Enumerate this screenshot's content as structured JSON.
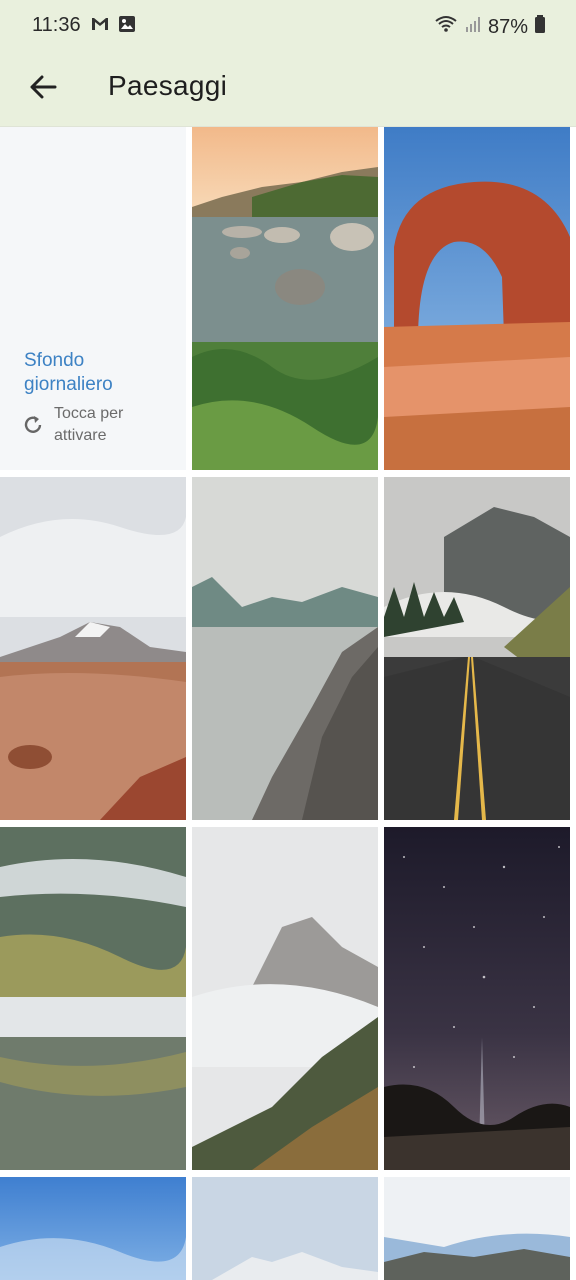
{
  "status_bar": {
    "time": "11:36",
    "notifications": [
      "gmail-icon",
      "image-icon"
    ],
    "battery": "87%"
  },
  "app_bar": {
    "back_icon": "arrow-left-icon",
    "title": "Paesaggi"
  },
  "daily_wallpaper": {
    "label": "Sfondo giornaliero",
    "action_icon": "refresh-icon",
    "action_text": "Tocca per attivare",
    "label_color": "#3d82c4"
  },
  "wallpapers": [
    {
      "id": "lake-rocks"
    },
    {
      "id": "red-arch"
    },
    {
      "id": "desert-volcano"
    },
    {
      "id": "misty-lake-shore"
    },
    {
      "id": "mountain-road"
    },
    {
      "id": "foggy-forest-lake"
    },
    {
      "id": "misty-peaks"
    },
    {
      "id": "starry-sky"
    },
    {
      "id": "blue-sky"
    },
    {
      "id": "snowy-peaks"
    },
    {
      "id": "cloudy-mountain"
    }
  ],
  "colors": {
    "app_bar_bg": "#e9f0dd",
    "accent": "#3d82c4"
  }
}
